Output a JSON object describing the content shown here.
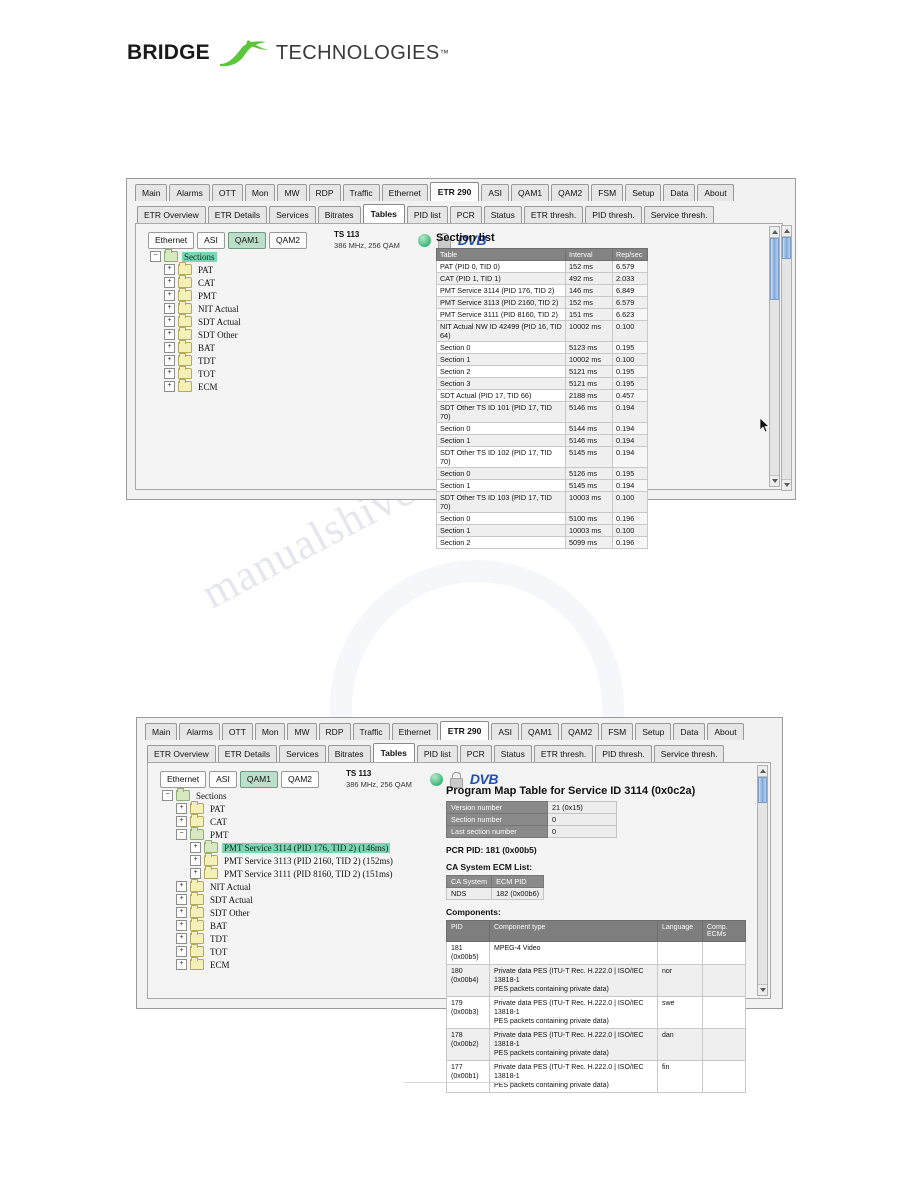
{
  "logo": {
    "primary": "BRIDGE",
    "secondary": "TECHNOLOGIES",
    "tm": "™",
    "accent_color": "#5bc63c"
  },
  "app": {
    "main_tabs": [
      "Main",
      "Alarms",
      "OTT",
      "Mon",
      "MW",
      "RDP",
      "Traffic",
      "Ethernet",
      "ETR 290",
      "ASI",
      "QAM1",
      "QAM2",
      "FSM",
      "Setup",
      "Data",
      "About"
    ],
    "main_tab_active": "ETR 290",
    "sub_tabs": [
      "ETR Overview",
      "ETR Details",
      "Services",
      "Bitrates",
      "Tables",
      "PID list",
      "PCR",
      "Status",
      "ETR thresh.",
      "PID thresh.",
      "Service thresh."
    ],
    "sub_tab_active": "Tables",
    "source_buttons": [
      "Ethernet",
      "ASI",
      "QAM1",
      "QAM2"
    ],
    "source_selected": "QAM1",
    "ts": {
      "name": "TS 113",
      "details": "386 MHz, 256 QAM"
    },
    "status_dot": "green",
    "lock_icon": "lock-icon",
    "dvb_logo": "DVB"
  },
  "screenshot1": {
    "tree": [
      {
        "label": "Sections",
        "depth": 0,
        "expander": "−",
        "open": true,
        "selected": true
      },
      {
        "label": "PAT",
        "depth": 1,
        "expander": "+",
        "open": false,
        "selected": false
      },
      {
        "label": "CAT",
        "depth": 1,
        "expander": "+",
        "open": false,
        "selected": false
      },
      {
        "label": "PMT",
        "depth": 1,
        "expander": "+",
        "open": false,
        "selected": false
      },
      {
        "label": "NIT Actual",
        "depth": 1,
        "expander": "+",
        "open": false,
        "selected": false
      },
      {
        "label": "SDT Actual",
        "depth": 1,
        "expander": "+",
        "open": false,
        "selected": false
      },
      {
        "label": "SDT Other",
        "depth": 1,
        "expander": "+",
        "open": false,
        "selected": false
      },
      {
        "label": "BAT",
        "depth": 1,
        "expander": "+",
        "open": false,
        "selected": false
      },
      {
        "label": "TDT",
        "depth": 1,
        "expander": "+",
        "open": false,
        "selected": false
      },
      {
        "label": "TOT",
        "depth": 1,
        "expander": "+",
        "open": false,
        "selected": false
      },
      {
        "label": "ECM",
        "depth": 1,
        "expander": "+",
        "open": false,
        "selected": false
      }
    ],
    "section_list": {
      "title": "Section list",
      "headers": [
        "Table",
        "Interval",
        "Rep/sec"
      ],
      "rows": [
        {
          "table": "PAT (PID 0, TID 0)",
          "interval": "152 ms",
          "rep": "6.579",
          "indent": false
        },
        {
          "table": "CAT (PID 1, TID 1)",
          "interval": "492 ms",
          "rep": "2.033",
          "indent": false
        },
        {
          "table": "PMT Service 3114 (PID 176, TID 2)",
          "interval": "146 ms",
          "rep": "6.849",
          "indent": false
        },
        {
          "table": "PMT Service 3113 (PID 2160, TID 2)",
          "interval": "152 ms",
          "rep": "6.579",
          "indent": false
        },
        {
          "table": "PMT Service 3111 (PID 8160, TID 2)",
          "interval": "151 ms",
          "rep": "6.623",
          "indent": false
        },
        {
          "table": "NIT Actual NW ID 42499 (PID 16, TID 64)",
          "interval": "10002 ms",
          "rep": "0.100",
          "indent": false
        },
        {
          "table": "Section 0",
          "interval": "5123 ms",
          "rep": "0.195",
          "indent": true
        },
        {
          "table": "Section 1",
          "interval": "10002 ms",
          "rep": "0.100",
          "indent": true
        },
        {
          "table": "Section 2",
          "interval": "5121 ms",
          "rep": "0.195",
          "indent": true
        },
        {
          "table": "Section 3",
          "interval": "5121 ms",
          "rep": "0.195",
          "indent": true
        },
        {
          "table": "SDT Actual (PID 17, TID 66)",
          "interval": "2188 ms",
          "rep": "0.457",
          "indent": false
        },
        {
          "table": "SDT Other TS ID 101 (PID 17, TID 70)",
          "interval": "5146 ms",
          "rep": "0.194",
          "indent": false
        },
        {
          "table": "Section 0",
          "interval": "5144 ms",
          "rep": "0.194",
          "indent": true
        },
        {
          "table": "Section 1",
          "interval": "5146 ms",
          "rep": "0.194",
          "indent": true
        },
        {
          "table": "SDT Other TS ID 102 (PID 17, TID 70)",
          "interval": "5145 ms",
          "rep": "0.194",
          "indent": false
        },
        {
          "table": "Section 0",
          "interval": "5126 ms",
          "rep": "0.195",
          "indent": true
        },
        {
          "table": "Section 1",
          "interval": "5145 ms",
          "rep": "0.194",
          "indent": true
        },
        {
          "table": "SDT Other TS ID 103 (PID 17, TID 70)",
          "interval": "10003 ms",
          "rep": "0.100",
          "indent": false
        },
        {
          "table": "Section 0",
          "interval": "5100 ms",
          "rep": "0.196",
          "indent": true
        },
        {
          "table": "Section 1",
          "interval": "10003 ms",
          "rep": "0.100",
          "indent": true
        },
        {
          "table": "Section 2",
          "interval": "5099 ms",
          "rep": "0.196",
          "indent": true
        }
      ]
    }
  },
  "screenshot2": {
    "tree": [
      {
        "label": "Sections",
        "depth": 0,
        "expander": "−",
        "open": true,
        "selected": false
      },
      {
        "label": "PAT",
        "depth": 1,
        "expander": "+",
        "open": false,
        "selected": false
      },
      {
        "label": "CAT",
        "depth": 1,
        "expander": "+",
        "open": false,
        "selected": false
      },
      {
        "label": "PMT",
        "depth": 1,
        "expander": "−",
        "open": true,
        "selected": false
      },
      {
        "label": "PMT Service 3114 (PID 176, TID 2) (146ms)",
        "depth": 2,
        "expander": "+",
        "open": true,
        "selected": true
      },
      {
        "label": "PMT Service 3113 (PID 2160, TID 2) (152ms)",
        "depth": 2,
        "expander": "+",
        "open": false,
        "selected": false
      },
      {
        "label": "PMT Service 3111 (PID 8160, TID 2) (151ms)",
        "depth": 2,
        "expander": "+",
        "open": false,
        "selected": false
      },
      {
        "label": "NIT Actual",
        "depth": 1,
        "expander": "+",
        "open": false,
        "selected": false
      },
      {
        "label": "SDT Actual",
        "depth": 1,
        "expander": "+",
        "open": false,
        "selected": false
      },
      {
        "label": "SDT Other",
        "depth": 1,
        "expander": "+",
        "open": false,
        "selected": false
      },
      {
        "label": "BAT",
        "depth": 1,
        "expander": "+",
        "open": false,
        "selected": false
      },
      {
        "label": "TDT",
        "depth": 1,
        "expander": "+",
        "open": false,
        "selected": false
      },
      {
        "label": "TOT",
        "depth": 1,
        "expander": "+",
        "open": false,
        "selected": false
      },
      {
        "label": "ECM",
        "depth": 1,
        "expander": "+",
        "open": false,
        "selected": false
      }
    ],
    "detail": {
      "title": "Program Map Table for Service ID 3114 (0x0c2a)",
      "kv": [
        {
          "key": "Version number",
          "value": "21 (0x15)"
        },
        {
          "key": "Section number",
          "value": "0"
        },
        {
          "key": "Last section number",
          "value": "0"
        }
      ],
      "pcr_pid": "PCR PID: 181 (0x00b5)",
      "ca_heading": "CA System ECM List:",
      "ca_headers": [
        "CA System",
        "ECM PID"
      ],
      "ca_rows": [
        {
          "system": "NDS",
          "ecm_pid": "182 (0x00b6)"
        }
      ],
      "components_heading": "Components:",
      "components_headers": [
        "PID",
        "Component type",
        "Language",
        "Comp. ECMs"
      ],
      "components": [
        {
          "pid": "181",
          "pid_hex": "(0x00b5)",
          "type": "MPEG-4 Video",
          "type2": "",
          "lang": "",
          "ecms": ""
        },
        {
          "pid": "180",
          "pid_hex": "(0x00b4)",
          "type": "Private data PES (ITU-T Rec. H.222.0 | ISO/IEC 13818-1",
          "type2": "PES packets containing private data)",
          "lang": "nor",
          "ecms": ""
        },
        {
          "pid": "179",
          "pid_hex": "(0x00b3)",
          "type": "Private data PES (ITU-T Rec. H.222.0 | ISO/IEC 13818-1",
          "type2": "PES packets containing private data)",
          "lang": "swe",
          "ecms": ""
        },
        {
          "pid": "178",
          "pid_hex": "(0x00b2)",
          "type": "Private data PES (ITU-T Rec. H.222.0 | ISO/IEC 13818-1",
          "type2": "PES packets containing private data)",
          "lang": "dan",
          "ecms": ""
        },
        {
          "pid": "177",
          "pid_hex": "(0x00b1)",
          "type": "Private data PES (ITU-T Rec. H.222.0 | ISO/IEC 13818-1",
          "type2": "PES packets containing private data)",
          "lang": "fin",
          "ecms": ""
        }
      ]
    }
  },
  "watermark": {
    "text": "manualshive.com"
  }
}
